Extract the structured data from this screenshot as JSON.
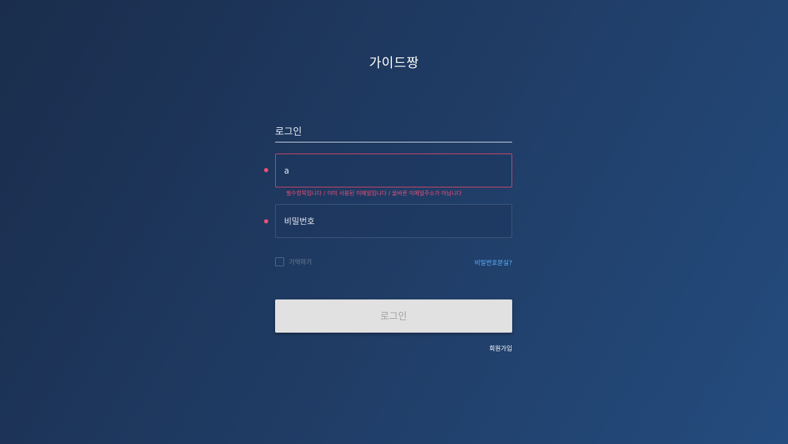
{
  "app": {
    "title": "가이드짱"
  },
  "form": {
    "heading": "로그인",
    "email": {
      "value": "a",
      "placeholder": ""
    },
    "email_error": "필수항목입니다 / 이미 사용된 이메일입니다 / 올바른 이메일주소가 아닙니다",
    "password": {
      "placeholder": "비밀번호"
    },
    "remember_label": "기억하기",
    "forgot_link": "비밀번호분실?",
    "submit_label": "로그인",
    "signup_link": "회원가입"
  },
  "colors": {
    "background_start": "#1a2d4c",
    "background_end": "#244c7e",
    "error": "#f0507a",
    "link": "#5fb0ff",
    "button_bg": "#e1e1e1"
  }
}
